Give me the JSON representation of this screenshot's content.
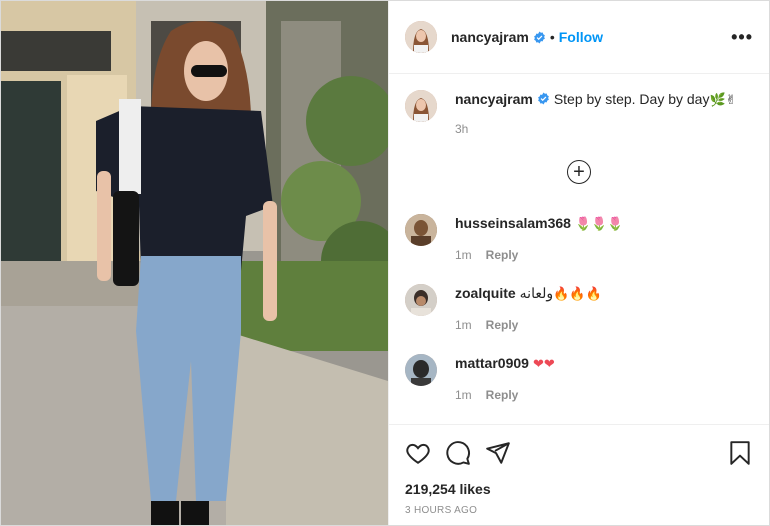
{
  "post": {
    "username": "nancyajram",
    "follow_label": "Follow",
    "separator": "•",
    "more_label": "•••"
  },
  "caption": {
    "username": "nancyajram",
    "text": "Step by step. Day by day",
    "emoji": "🌿✌",
    "time": "3h"
  },
  "comments": [
    {
      "username": "husseinsalam368",
      "text": "",
      "emoji": "🌷🌷🌷",
      "time": "1m",
      "reply": "Reply"
    },
    {
      "username": "zoalquite",
      "text": "ولعانه",
      "emoji": "🔥🔥🔥",
      "time": "1m",
      "reply": "Reply"
    },
    {
      "username": "mattar0909",
      "text": "",
      "emoji": "❤❤",
      "time": "1m",
      "reply": "Reply"
    }
  ],
  "likes": "219,254 likes",
  "date": "3 HOURS AGO",
  "colors": {
    "accent": "#0095f6",
    "verified": "#3897f0",
    "heart": "#ed4956"
  }
}
